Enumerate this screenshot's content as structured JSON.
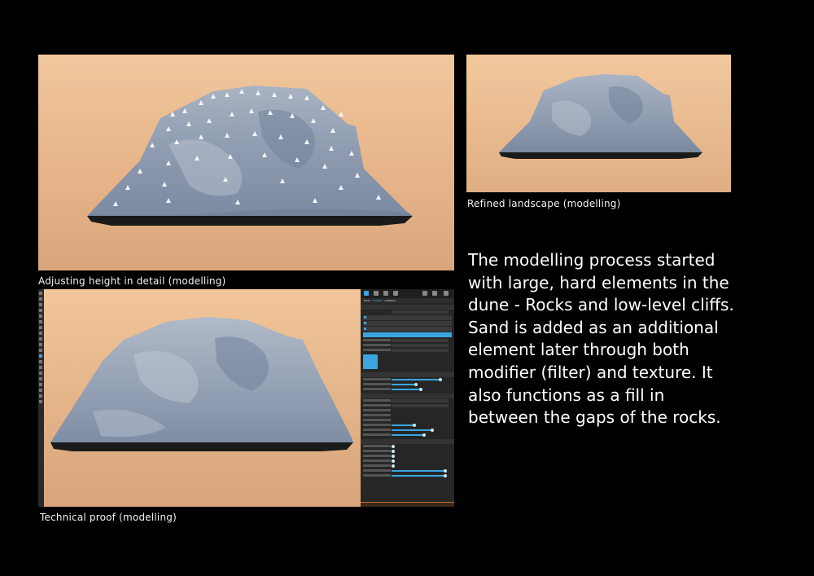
{
  "captions": {
    "adjusting": "Adjusting height in detail (modelling)",
    "refined": "Refined landscape (modelling)",
    "technical": "Technical proof (modelling)"
  },
  "paragraph": "The modelling process started with large, hard elements in the dune - Rocks and low-level cliffs. Sand is added as an additional element later through both modifier (filter) and texture. It also functions as a fill in between the gaps of the rocks.",
  "colors": {
    "background": "#000000",
    "sky": "#e8b88a",
    "terrain": "#8d9aae",
    "accent": "#39a6e0"
  },
  "panel": {
    "tabs": [
      "BASE",
      "FILTERS",
      "GENERAL"
    ],
    "icons": [
      "arrow-icon",
      "brush-icon",
      "sculpt-icon",
      "grid-icon",
      "stamp-icon",
      "export-icon",
      "gear-icon"
    ]
  }
}
